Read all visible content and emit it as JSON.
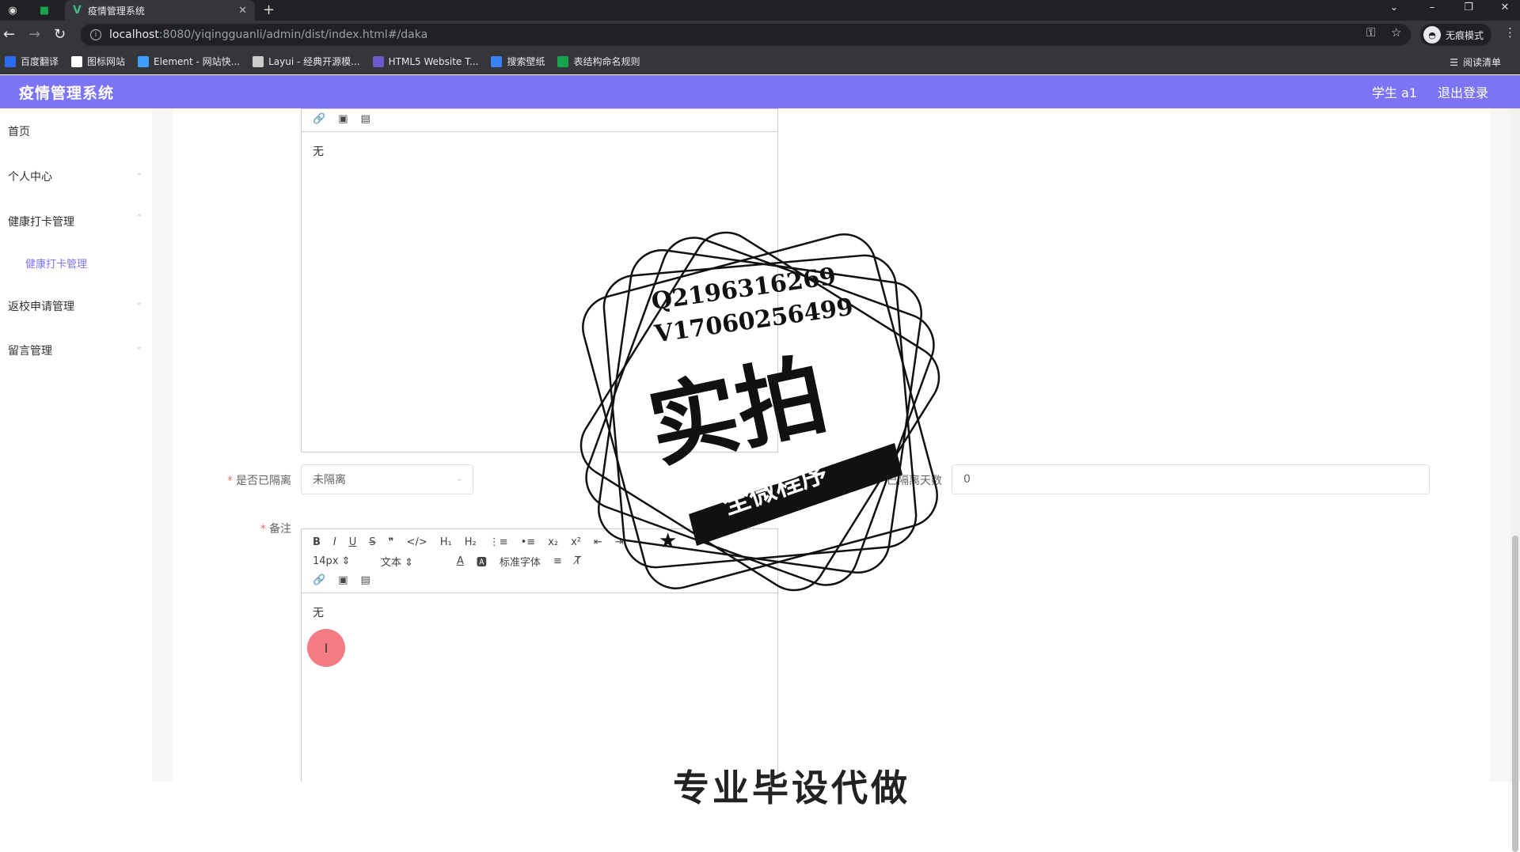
{
  "browser": {
    "tab_title": "疫情管理系统",
    "url_host": "localhost",
    "url_path": ":8080/yiqingguanli/admin/dist/index.html#/daka",
    "incognito_label": "无痕模式",
    "reading_list": "阅读清单",
    "bookmarks": [
      {
        "label": "百度翻译",
        "color": "#2a6bf2"
      },
      {
        "label": "图标网站",
        "color": "#ffffff"
      },
      {
        "label": "Element - 网站快...",
        "color": "#409eff"
      },
      {
        "label": "Layui - 经典开源模...",
        "color": "#cccccc"
      },
      {
        "label": "HTML5 Website T...",
        "color": "#6a5acd"
      },
      {
        "label": "搜索壁纸",
        "color": "#3b82f6"
      },
      {
        "label": "表结构命名规则",
        "color": "#16a34a"
      }
    ]
  },
  "app": {
    "title": "疫情管理系统",
    "user": "学生 a1",
    "logout": "退出登录",
    "accent_color": "#7b75f6"
  },
  "sidebar": {
    "items": [
      {
        "label": "首页"
      },
      {
        "label": "个人中心"
      },
      {
        "label": "健康打卡管理"
      },
      {
        "label": "返校申请管理"
      },
      {
        "label": "留言管理"
      }
    ],
    "sub_item": "健康打卡管理"
  },
  "form": {
    "editor1_content": "无",
    "isolated_label": "是否已隔离",
    "isolated_value": "未隔离",
    "days_label": "已隔离天数",
    "days_value": "0",
    "remark_label": "备注",
    "editor2_content": "无",
    "toolbar": {
      "font_size": "14px",
      "block_type": "文本",
      "font_family": "标准字体"
    }
  },
  "watermark": {
    "qq": "Q2196316269",
    "wechat": "V17060256499",
    "big": "实拍",
    "banner": "全微程序",
    "bottom": "专业毕设代做"
  }
}
